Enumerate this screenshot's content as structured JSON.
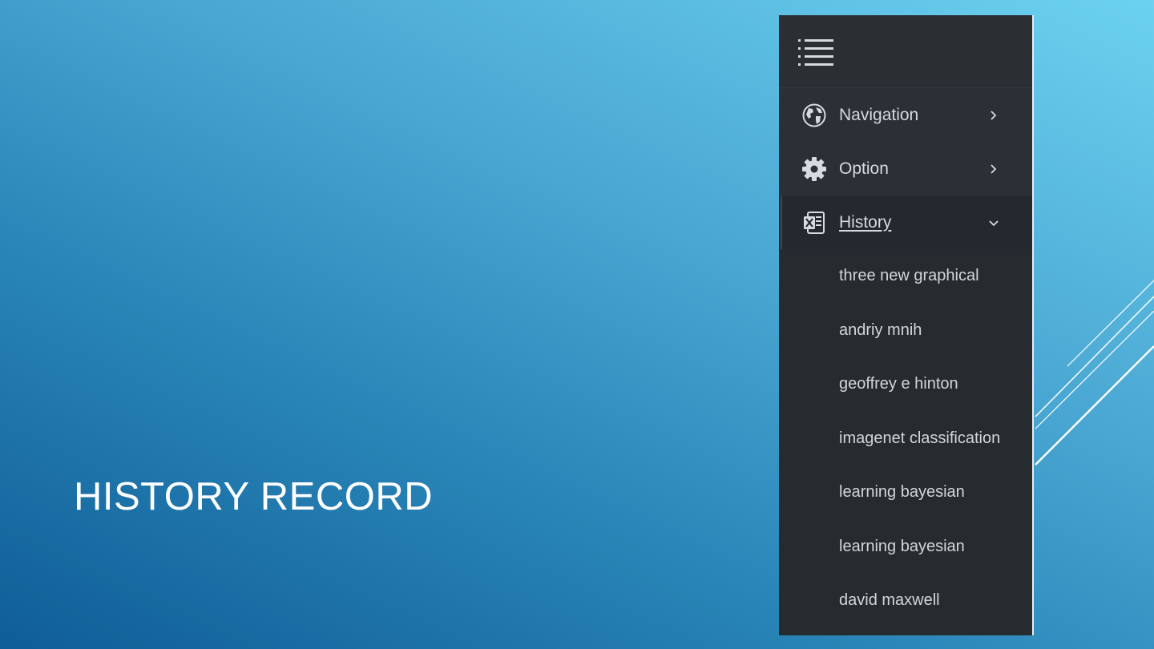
{
  "slide": {
    "title": "HISTORY RECORD"
  },
  "sidebar": {
    "menu_icon": "hamburger-icon",
    "items": [
      {
        "label": "Navigation",
        "icon": "globe-icon",
        "chevron": "chevron-right-icon"
      },
      {
        "label": "Option",
        "icon": "gear-icon",
        "chevron": "chevron-right-icon"
      },
      {
        "label": "History",
        "icon": "excel-file-icon",
        "chevron": "chevron-down-icon",
        "active": true
      }
    ],
    "history": [
      "three new graphical",
      "andriy mnih",
      "geoffrey e hinton",
      "imagenet classification",
      "learning bayesian",
      "learning bayesian",
      "david maxwell"
    ]
  }
}
